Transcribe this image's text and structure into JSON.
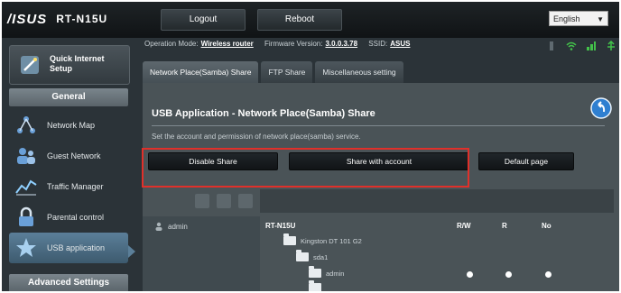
{
  "header": {
    "brand": "/ISUS",
    "model": "RT-N15U",
    "logout_label": "Logout",
    "reboot_label": "Reboot",
    "language": "English"
  },
  "status": {
    "op_mode_label": "Operation Mode:",
    "op_mode_value": "Wireless router",
    "firmware_label": "Firmware Version:",
    "firmware_value": "3.0.0.3.78",
    "ssid_label": "SSID:",
    "ssid_value": "ASUS"
  },
  "sidebar": {
    "qis_label": "Quick Internet Setup",
    "general_label": "General",
    "advanced_label": "Advanced Settings",
    "items": [
      {
        "label": "Network Map",
        "icon": "network-map-icon"
      },
      {
        "label": "Guest Network",
        "icon": "guest-network-icon"
      },
      {
        "label": "Traffic Manager",
        "icon": "traffic-manager-icon"
      },
      {
        "label": "Parental control",
        "icon": "lock-icon"
      },
      {
        "label": "USB application",
        "icon": "usb-application-icon"
      }
    ]
  },
  "tabs": [
    {
      "label": "Network Place(Samba) Share"
    },
    {
      "label": "FTP Share"
    },
    {
      "label": "Miscellaneous setting"
    }
  ],
  "main": {
    "title": "USB Application - Network Place(Samba) Share",
    "description": "Set the account and permission of network place(samba) service.",
    "disable_share_label": "Disable Share",
    "share_with_account_label": "Share with account",
    "default_label": "Default page"
  },
  "accounts": [
    {
      "name": "admin"
    }
  ],
  "tree": {
    "device_name": "RT-N15U",
    "col_rw": "R/W",
    "col_r": "R",
    "col_no": "No",
    "disk_label": "Kingston DT 101 G2",
    "partition_label": "sda1",
    "folder_label": "admin"
  },
  "colors": {
    "highlight": "#e0302a",
    "frame_bg": "#2b3338",
    "panel_bg": "#4a5357"
  }
}
